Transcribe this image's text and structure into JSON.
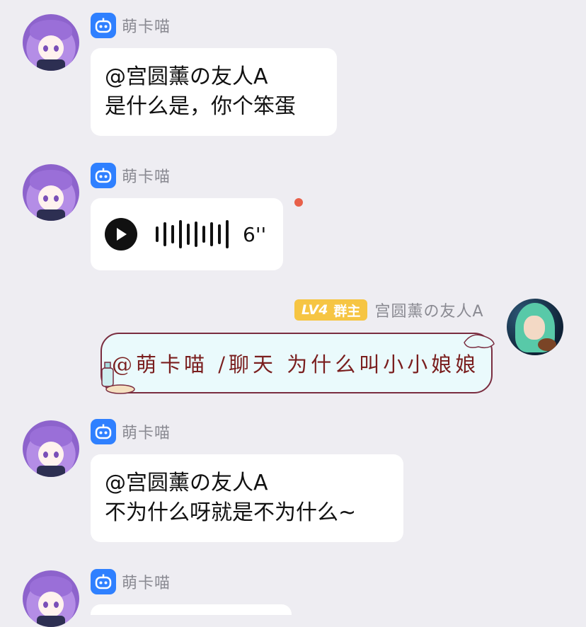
{
  "messages": [
    {
      "sender": "萌卡喵",
      "type": "text",
      "lines": [
        "@宫圆薰の友人A",
        "是什么是，你个笨蛋"
      ]
    },
    {
      "sender": "萌卡喵",
      "type": "voice",
      "duration": "6''",
      "unread": true
    },
    {
      "sender": "宫圆薰の友人A",
      "type": "text",
      "level": "LV4",
      "role": "群主",
      "text": "@萌卡喵 /聊天 为什么叫小小娘娘"
    },
    {
      "sender": "萌卡喵",
      "type": "text",
      "lines": [
        "@宫圆薰の友人A",
        "不为什么呀就是不为什么~"
      ]
    },
    {
      "sender": "萌卡喵",
      "type": "text"
    }
  ],
  "colors": {
    "background": "#eeedf2",
    "bot_badge": "#2f80ff",
    "level_badge": "#f6c543",
    "unread_dot": "#e8604a"
  },
  "icons": {
    "bot_badge": "robot-icon",
    "voice_play": "play-icon"
  }
}
